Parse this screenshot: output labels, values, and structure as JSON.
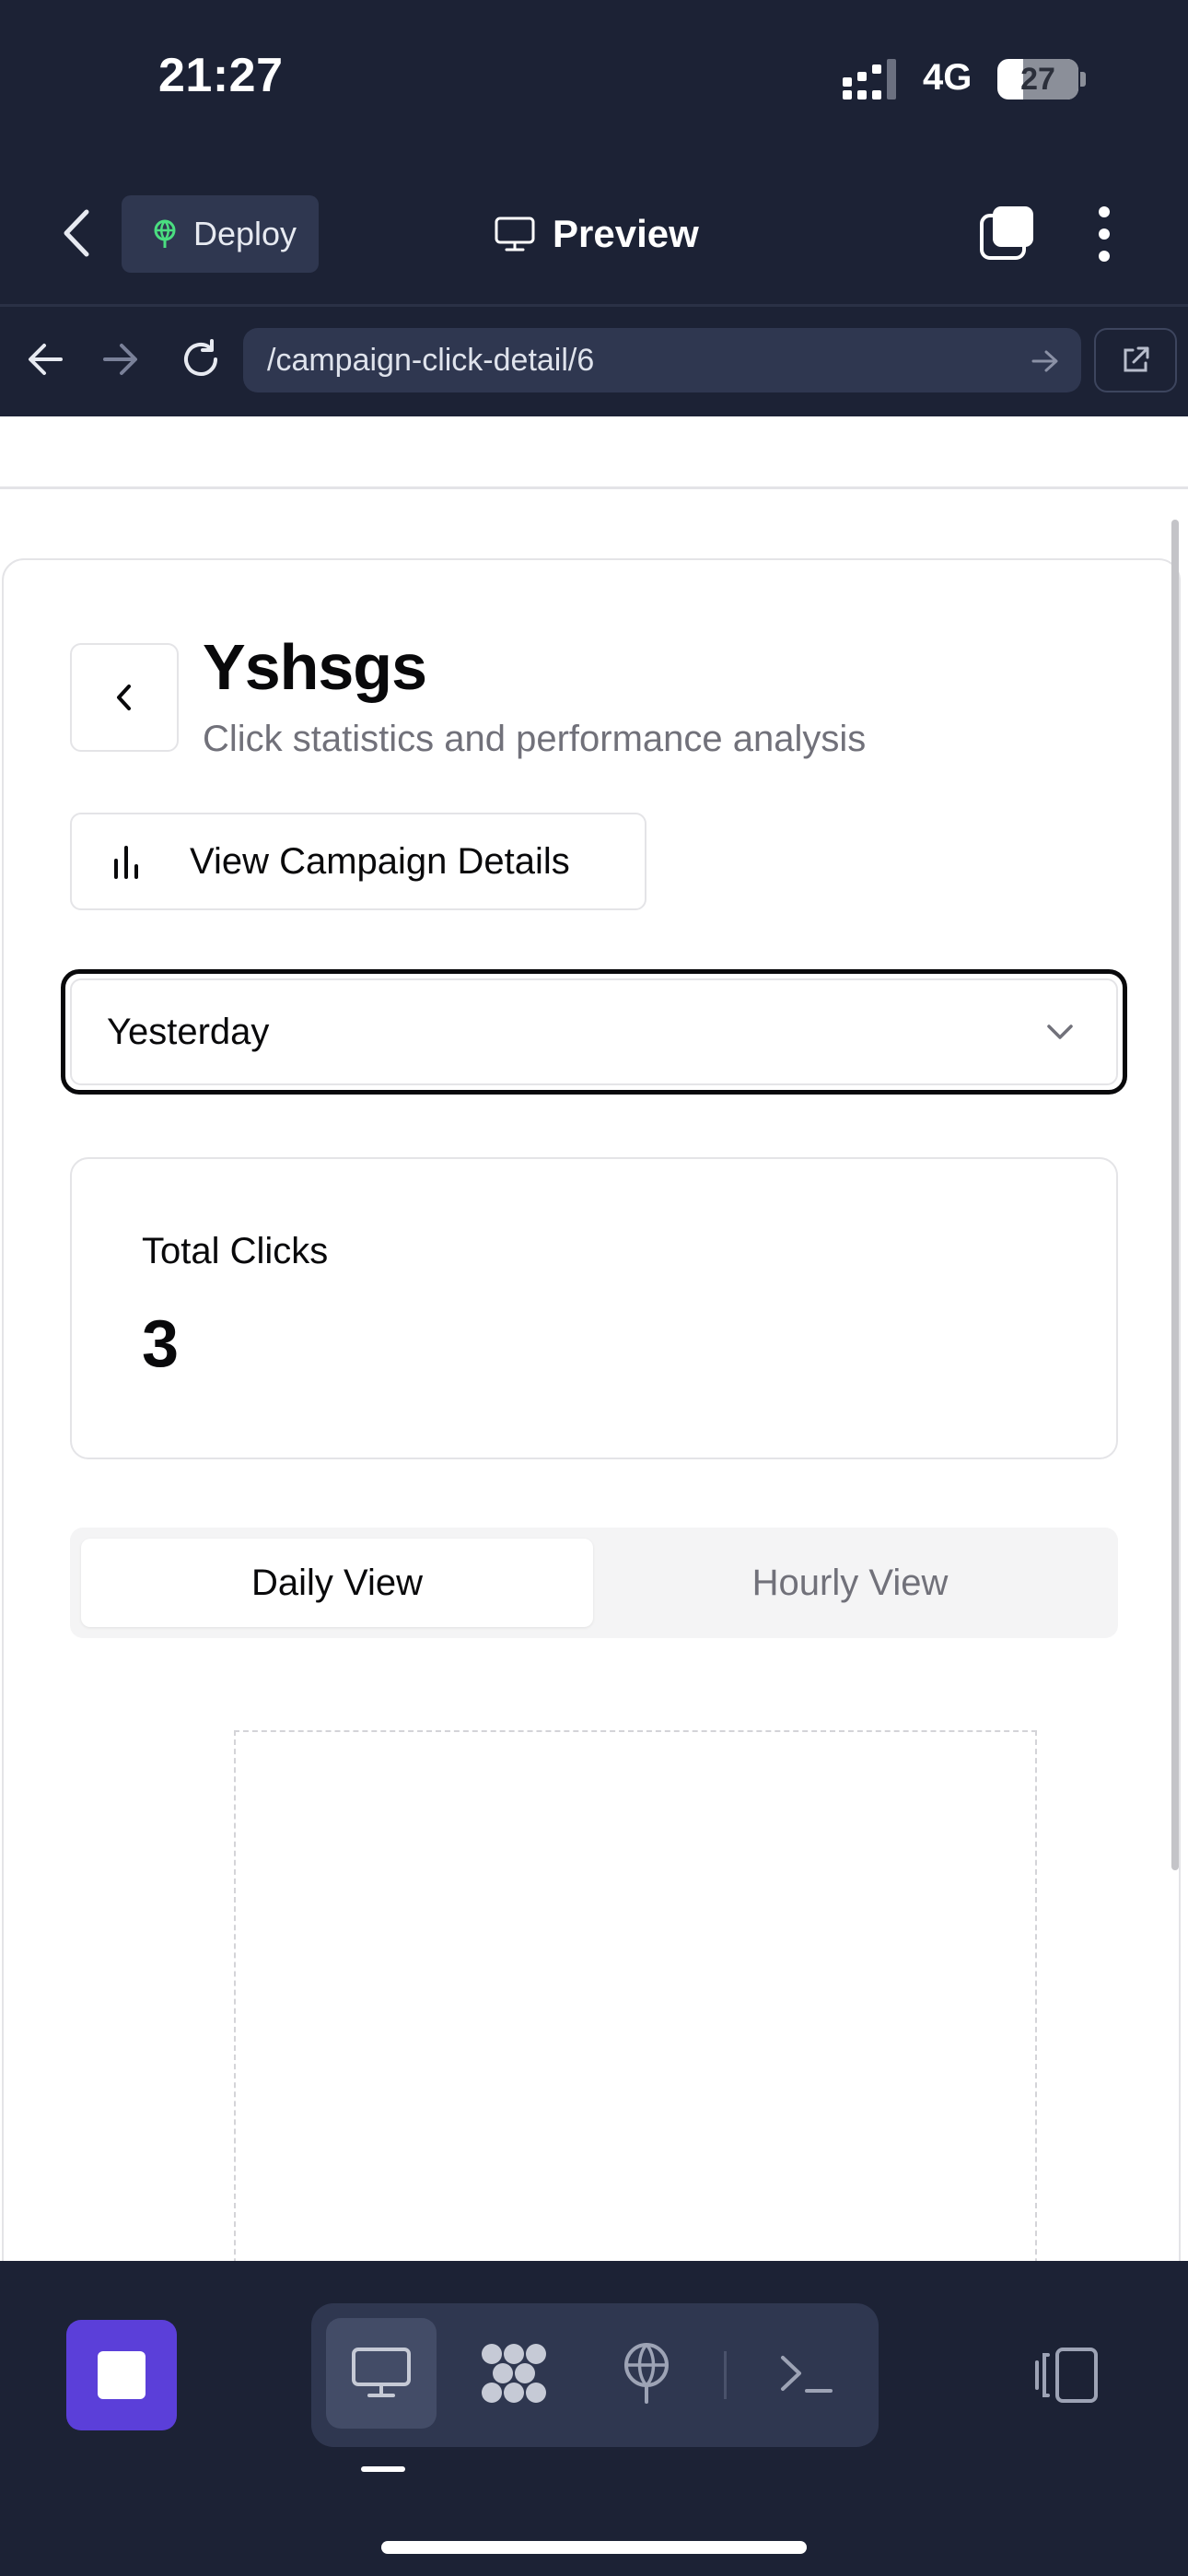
{
  "status_bar": {
    "time": "21:27",
    "network": "4G",
    "battery": "27"
  },
  "toolbar": {
    "deploy_label": "Deploy",
    "preview_label": "Preview"
  },
  "address_bar": {
    "url": "/campaign-click-detail/6"
  },
  "page": {
    "title": "Yshsgs",
    "subtitle": "Click statistics and performance analysis",
    "details_button": "View Campaign Details",
    "date_range": "Yesterday",
    "stat": {
      "label": "Total Clicks",
      "value": "3"
    },
    "tabs": [
      {
        "label": "Daily View",
        "active": true
      },
      {
        "label": "Hourly View",
        "active": false
      }
    ]
  },
  "colors": {
    "app_bg": "#1c2235",
    "accent": "#5b3fd9",
    "deploy_icon": "#4ade80"
  },
  "icons": {
    "toolbar": [
      "chevron-left-icon",
      "globe-icon",
      "monitor-icon",
      "tabs-icon",
      "more-vertical-icon"
    ],
    "address": [
      "arrow-left-icon",
      "arrow-right-icon",
      "reload-icon",
      "external-link-icon"
    ],
    "dock": [
      "monitor-icon",
      "apps-icon",
      "globe-icon",
      "terminal-icon"
    ]
  }
}
